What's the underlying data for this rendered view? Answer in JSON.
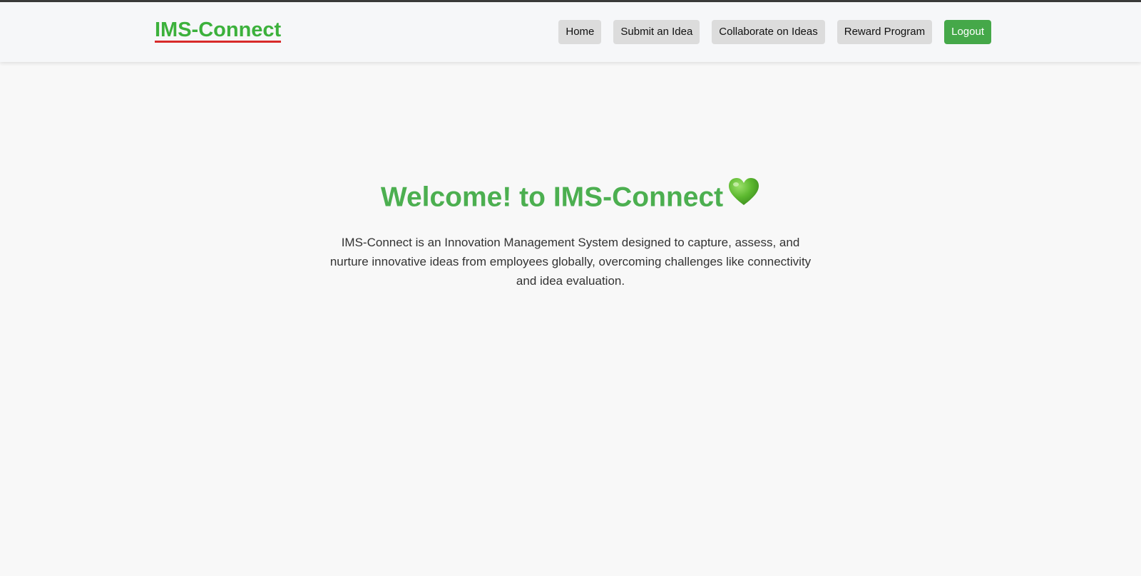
{
  "brand": {
    "name": "IMS-Connect"
  },
  "nav": {
    "items": [
      {
        "label": "Home"
      },
      {
        "label": "Submit an Idea"
      },
      {
        "label": "Collaborate on Ideas"
      },
      {
        "label": "Reward Program"
      },
      {
        "label": "Logout"
      }
    ]
  },
  "hero": {
    "title": "Welcome! to IMS-Connect",
    "icon": "green-heart-icon",
    "description": "IMS-Connect is an Innovation Management System designed to capture, assess, and nurture innovative ideas from employees globally, overcoming challenges like connectivity and idea evaluation."
  },
  "colors": {
    "brand": "#3cb13c",
    "brand_underline": "#d82a2a",
    "title": "#4caf50",
    "logout_button": "#45a849",
    "nav_button": "#dcdcdc"
  }
}
